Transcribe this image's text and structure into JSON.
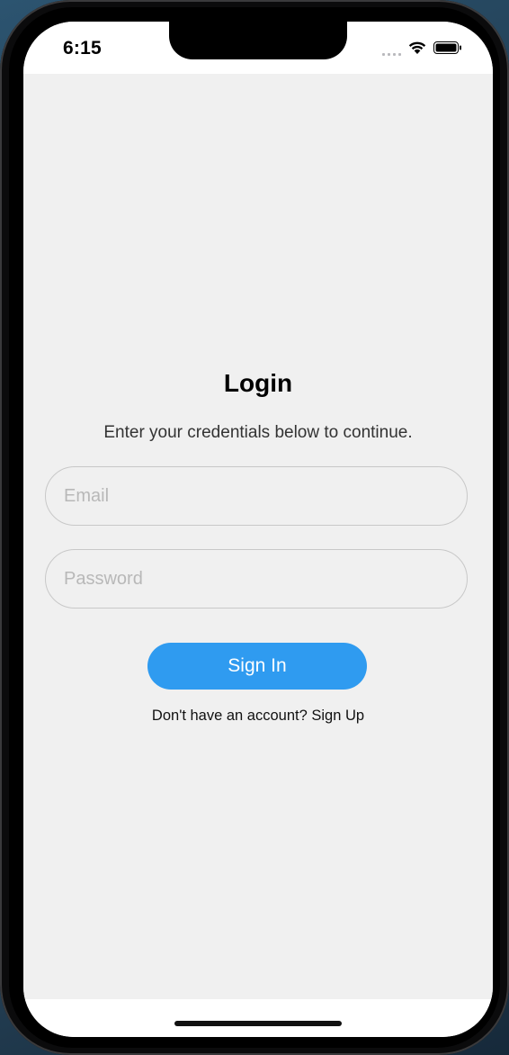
{
  "status_bar": {
    "time": "6:15"
  },
  "login": {
    "title": "Login",
    "subtitle": "Enter your credentials below to continue.",
    "email_placeholder": "Email",
    "email_value": "",
    "password_placeholder": "Password",
    "password_value": "",
    "sign_in_label": "Sign In",
    "sign_up_prompt": "Don't have an account? Sign Up"
  },
  "colors": {
    "accent": "#2f9bf0",
    "background": "#f0f0f0",
    "field_border": "#c8c8c8"
  },
  "icons": {
    "signal": "cellular-signal-icon",
    "wifi": "wifi-icon",
    "battery": "battery-icon"
  }
}
